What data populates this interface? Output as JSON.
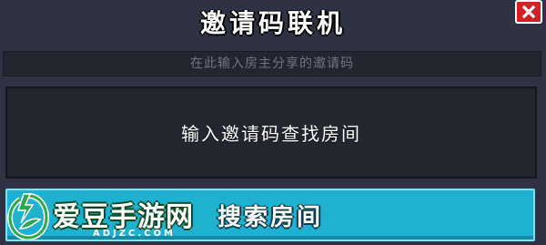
{
  "dialog": {
    "title": "邀请码联机",
    "hint": "在此输入房主分享的邀请码",
    "input_label": "输入邀请码查找房间",
    "search_button_label": "搜索房间",
    "close_icon": "close-icon"
  },
  "watermark": {
    "name": "爱豆手游网",
    "domain": "ADJZC.COM"
  },
  "colors": {
    "background": "#2e3242",
    "field": "#23262f",
    "button": "#1fb1d0",
    "close": "#d61f25",
    "watermark_green": "#2ea84a"
  }
}
